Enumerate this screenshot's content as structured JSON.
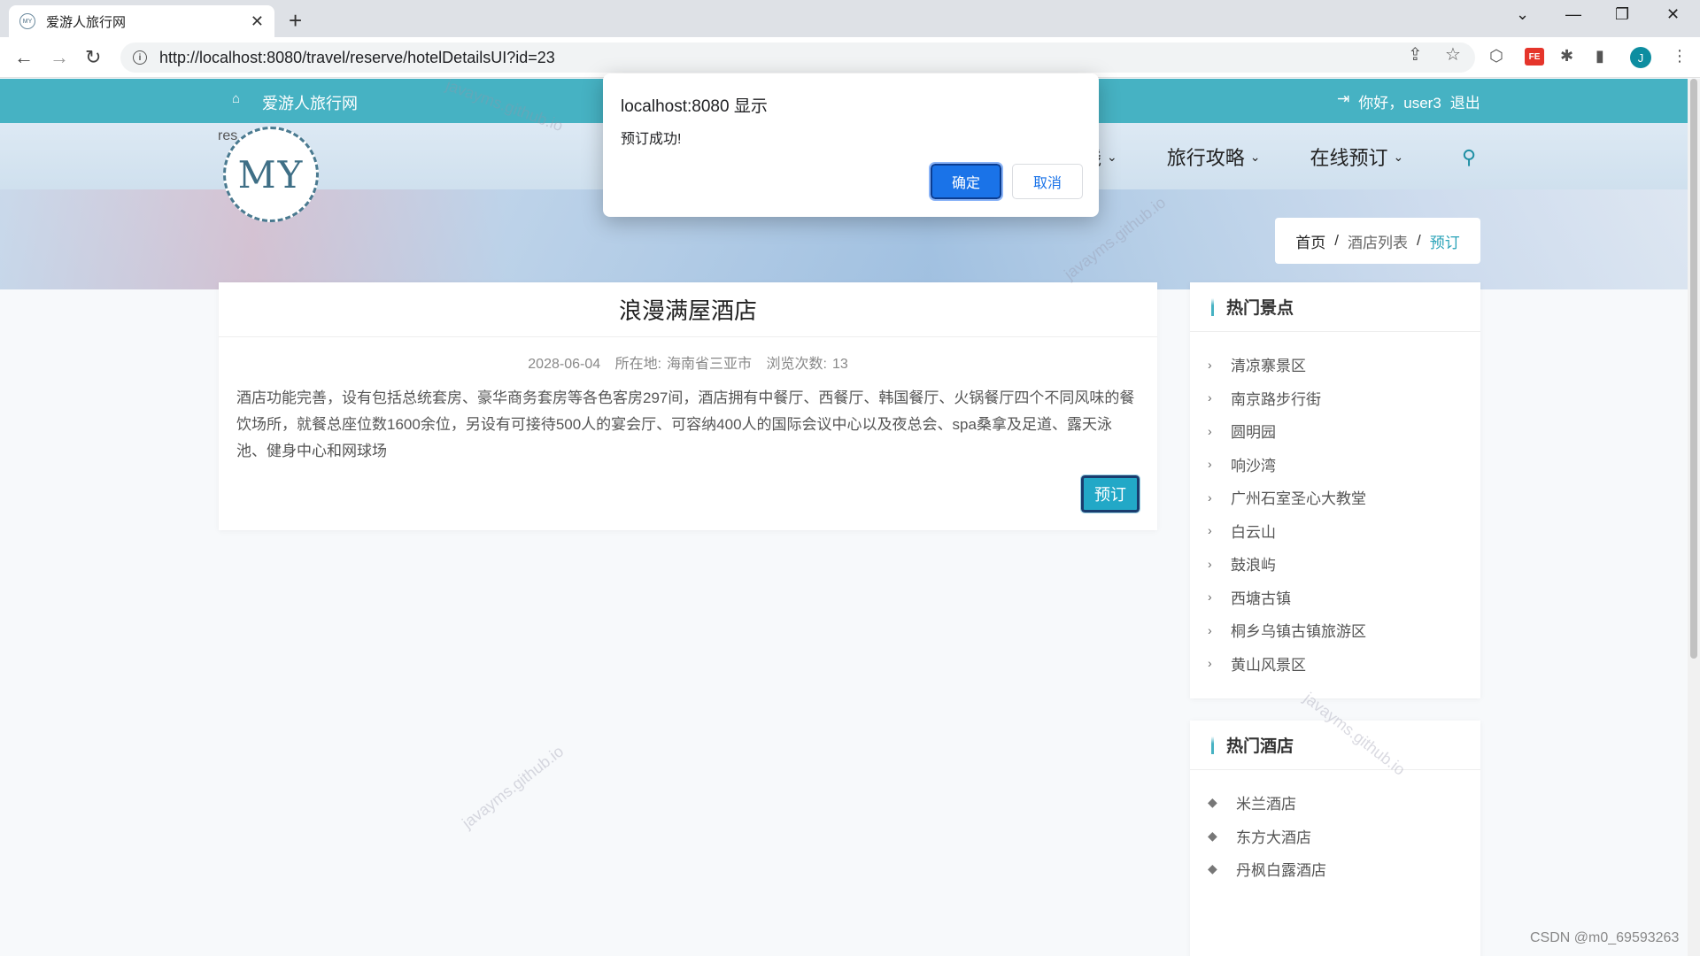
{
  "browser": {
    "tab_title": "爱游人旅行网",
    "favicon_text": "MY",
    "url": "http://localhost:8080/travel/reserve/hotelDetailsUI?id=23",
    "profile_initial": "J",
    "ext_fe": "FE"
  },
  "header": {
    "site_name": "爱游人旅行网",
    "greeting": "你好，user3",
    "logout": "退出"
  },
  "banner": {
    "logo_text": "MY",
    "res_text": "res",
    "nav": [
      {
        "label": "线"
      },
      {
        "label": "旅行攻略"
      },
      {
        "label": "在线预订"
      }
    ],
    "breadcrumb": {
      "home": "首页",
      "sep": "/",
      "list": "酒店列表",
      "current": "预订"
    }
  },
  "article": {
    "title": "浪漫满屋酒店",
    "date": "2028-06-04",
    "location_label": "所在地:",
    "location": "海南省三亚市",
    "views_label": "浏览次数:",
    "views": "13",
    "body": "酒店功能完善，设有包括总统套房、豪华商务套房等各色客房297间，酒店拥有中餐厅、西餐厅、韩国餐厅、火锅餐厅四个不同风味的餐饮场所，就餐总座位数1600余位，另设有可接待500人的宴会厅、可容纳400人的国际会议中心以及夜总会、spa桑拿及足道、露天泳池、健身中心和网球场",
    "reserve_label": "预订"
  },
  "sidebar": {
    "hot_spots": {
      "title": "热门景点",
      "items": [
        "清凉寨景区",
        "南京路步行街",
        "圆明园",
        "响沙湾",
        "广州石室圣心大教堂",
        "白云山",
        "鼓浪屿",
        "西塘古镇",
        "桐乡乌镇古镇旅游区",
        "黄山风景区"
      ]
    },
    "hot_hotels": {
      "title": "热门酒店",
      "items": [
        "米兰酒店",
        "东方大酒店",
        "丹枫白露酒店"
      ]
    }
  },
  "dialog": {
    "title": "localhost:8080 显示",
    "message": "预订成功!",
    "ok": "确定",
    "cancel": "取消"
  },
  "watermark": "javayms.github.io",
  "footer_mark": "CSDN @m0_69593263",
  "colors": {
    "accent": "#46b2c3",
    "link": "#2aa3b8",
    "dialog_primary": "#1a73e8"
  }
}
